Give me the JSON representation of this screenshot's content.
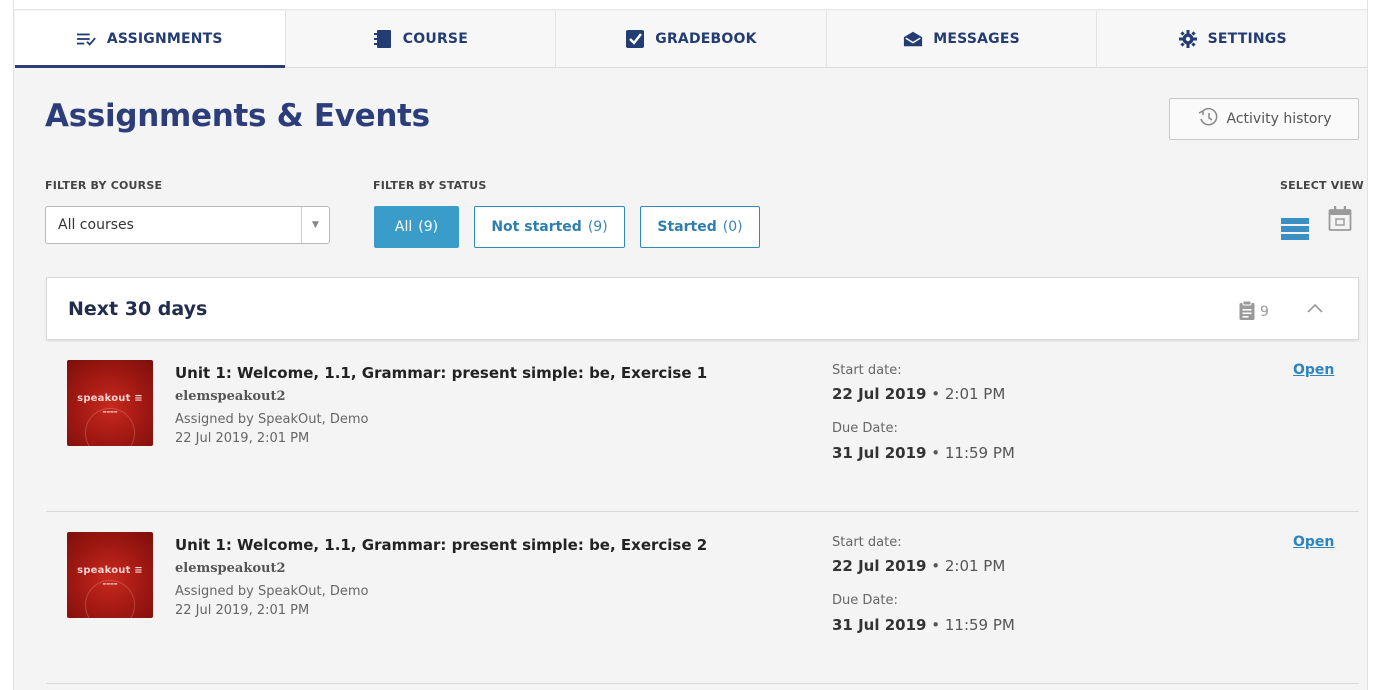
{
  "tabs": [
    {
      "label": "ASSIGNMENTS",
      "icon": "assignments-list-icon",
      "active": true
    },
    {
      "label": "COURSE",
      "icon": "book-icon",
      "active": false
    },
    {
      "label": "GRADEBOOK",
      "icon": "checkbox-icon",
      "active": false
    },
    {
      "label": "MESSAGES",
      "icon": "envelope-icon",
      "active": false
    },
    {
      "label": "SETTINGS",
      "icon": "gear-icon",
      "active": false
    }
  ],
  "header": {
    "title": "Assignments & Events",
    "activity_history_label": "Activity history"
  },
  "filters": {
    "course_label": "FILTER BY COURSE",
    "course_value": "All courses",
    "status_label": "FILTER BY STATUS",
    "status_options": [
      {
        "label": "All",
        "count": "(9)",
        "active": true
      },
      {
        "label": "Not started",
        "count": "(9)",
        "active": false
      },
      {
        "label": "Started",
        "count": "(0)",
        "active": false
      }
    ],
    "select_view_label": "SELECT VIEW"
  },
  "section": {
    "title": "Next 30 days",
    "count": "9"
  },
  "items": [
    {
      "title": "Unit 1: Welcome, 1.1, Grammar: present simple: be, Exercise 1",
      "course": "elemspeakout2",
      "assigned_by": "Assigned by SpeakOut, Demo",
      "assigned_date": "22 Jul 2019, 2:01 PM",
      "start_label": "Start date:",
      "start_date": "22 Jul 2019",
      "start_time": " • 2:01 PM",
      "due_label": "Due Date:",
      "due_date": "31 Jul 2019",
      "due_time": " • 11:59 PM",
      "action": "Open",
      "thumb_brand": "speakout ≡"
    },
    {
      "title": "Unit 1: Welcome, 1.1, Grammar: present simple: be, Exercise 2",
      "course": "elemspeakout2",
      "assigned_by": "Assigned by SpeakOut, Demo",
      "assigned_date": "22 Jul 2019, 2:01 PM",
      "start_label": "Start date:",
      "start_date": "22 Jul 2019",
      "start_time": " • 2:01 PM",
      "due_label": "Due Date:",
      "due_date": "31 Jul 2019",
      "due_time": " • 11:59 PM",
      "action": "Open",
      "thumb_brand": "speakout ≡"
    }
  ],
  "colors": {
    "brand_navy": "#2b3e7b",
    "accent_blue": "#3a9cc9",
    "link_blue": "#2e84bd",
    "thumb_red": "#a01812"
  }
}
